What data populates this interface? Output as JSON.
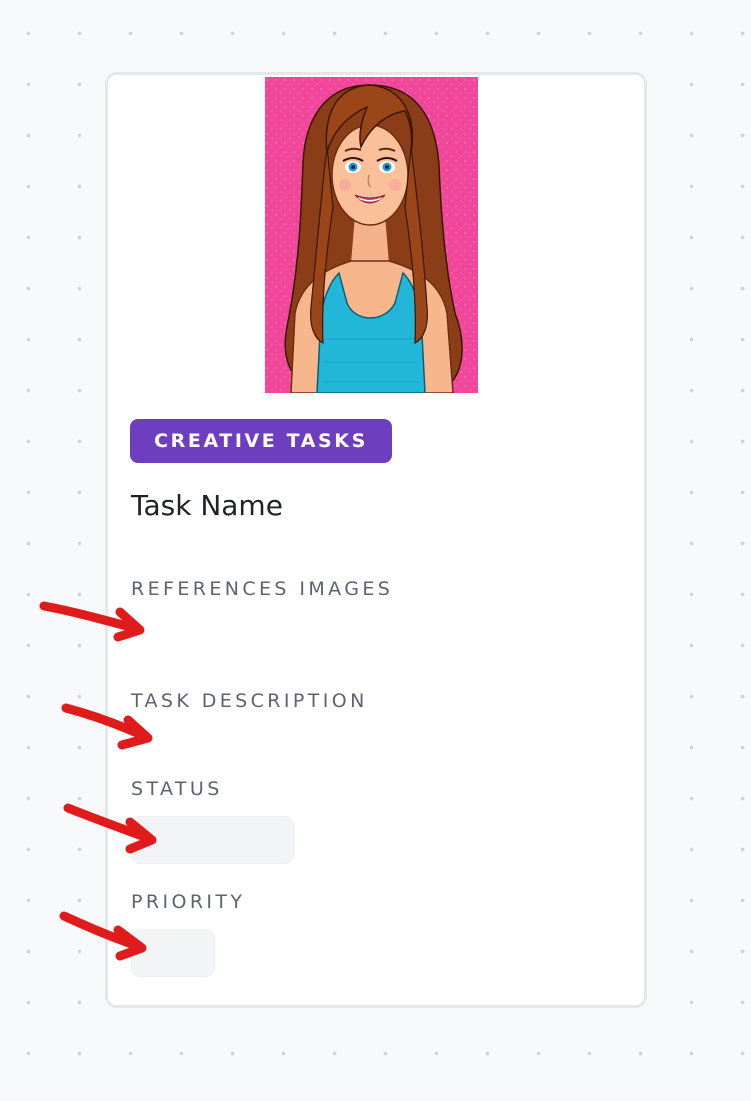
{
  "card": {
    "avatar_icon": "cartoon-woman-portrait",
    "category_badge": "CREATIVE TASKS",
    "task_name": "Task Name",
    "fields": {
      "references_label": "REFERENCES IMAGES",
      "references_value": "",
      "description_label": "TASK DESCRIPTION",
      "description_value": "",
      "status_label": "STATUS",
      "status_value": "",
      "priority_label": "PRIORITY",
      "priority_value": ""
    }
  },
  "annotations": {
    "arrow_icon": "red-hand-drawn-arrow",
    "count": 4
  },
  "colors": {
    "badge_background": "#6d3fc0",
    "badge_text": "#ffffff",
    "avatar_background": "#f0479a",
    "arrow": "#e01b1b",
    "label_text": "#5d6470",
    "pill_background": "#f3f4f6"
  }
}
